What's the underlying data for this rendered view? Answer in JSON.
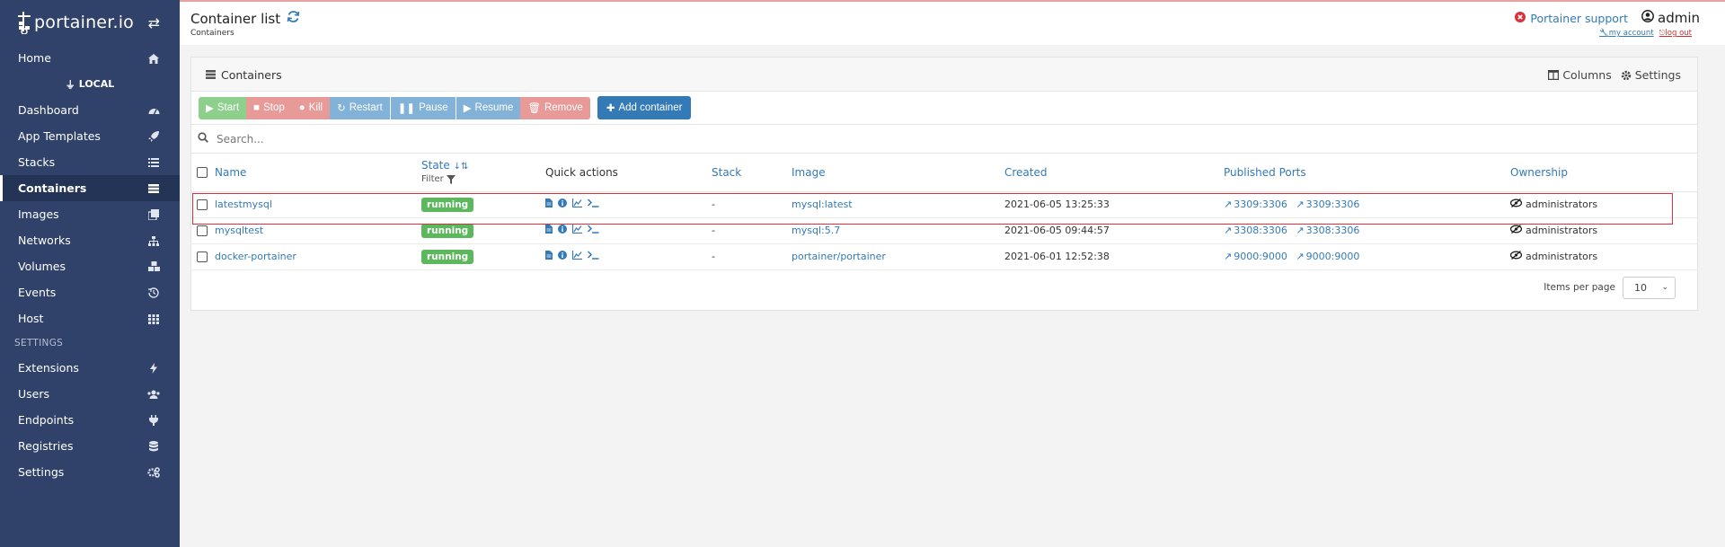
{
  "brand": {
    "name": "portainer.io"
  },
  "sidebar": {
    "items": [
      {
        "label": "Home",
        "icon": "home-icon"
      },
      {
        "label": "Dashboard",
        "icon": "tachometer-icon"
      },
      {
        "label": "App Templates",
        "icon": "rocket-icon"
      },
      {
        "label": "Stacks",
        "icon": "list-icon"
      },
      {
        "label": "Containers",
        "icon": "server-icon",
        "active": true
      },
      {
        "label": "Images",
        "icon": "clone-icon"
      },
      {
        "label": "Networks",
        "icon": "sitemap-icon"
      },
      {
        "label": "Volumes",
        "icon": "cubes-icon"
      },
      {
        "label": "Events",
        "icon": "history-icon"
      },
      {
        "label": "Host",
        "icon": "th-icon"
      }
    ],
    "endpoint_label": "LOCAL",
    "settings_section_label": "SETTINGS",
    "settings_items": [
      {
        "label": "Extensions",
        "icon": "bolt-icon"
      },
      {
        "label": "Users",
        "icon": "users-icon"
      },
      {
        "label": "Endpoints",
        "icon": "plug-icon"
      },
      {
        "label": "Registries",
        "icon": "database-icon"
      },
      {
        "label": "Settings",
        "icon": "cogs-icon"
      }
    ]
  },
  "header": {
    "title": "Container list",
    "breadcrumb": "Containers",
    "support_label": "Portainer support",
    "user_name": "admin",
    "my_account_label": "my account",
    "logout_label": "log out"
  },
  "panel": {
    "title": "Containers",
    "columns_label": "Columns",
    "settings_label": "Settings"
  },
  "toolbar": {
    "start": "Start",
    "stop": "Stop",
    "kill": "Kill",
    "restart": "Restart",
    "pause": "Pause",
    "resume": "Resume",
    "remove": "Remove",
    "add": "Add container"
  },
  "search": {
    "placeholder": "Search..."
  },
  "table": {
    "headers": {
      "name": "Name",
      "state": "State",
      "filter": "Filter",
      "quick_actions": "Quick actions",
      "stack": "Stack",
      "image": "Image",
      "created": "Created",
      "ports": "Published Ports",
      "ownership": "Ownership"
    },
    "rows": [
      {
        "name": "latestmysql",
        "state": "running",
        "stack": "-",
        "image": "mysql:latest",
        "created": "2021-06-05 13:25:33",
        "port1": "3309:3306",
        "port2": "3309:3306",
        "ownership": "administrators"
      },
      {
        "name": "mysqltest",
        "state": "running",
        "stack": "-",
        "image": "mysql:5.7",
        "created": "2021-06-05 09:44:57",
        "port1": "3308:3306",
        "port2": "3308:3306",
        "ownership": "administrators"
      },
      {
        "name": "docker-portainer",
        "state": "running",
        "stack": "-",
        "image": "portainer/portainer",
        "created": "2021-06-01 12:52:38",
        "port1": "9000:9000",
        "port2": "9000:9000",
        "ownership": "administrators"
      }
    ]
  },
  "pagination": {
    "label": "Items per page",
    "value": "10"
  },
  "colors": {
    "sidebar": "#30426a",
    "accent": "#337ab7",
    "success": "#5cb85c",
    "highlight": "#d9323a"
  }
}
